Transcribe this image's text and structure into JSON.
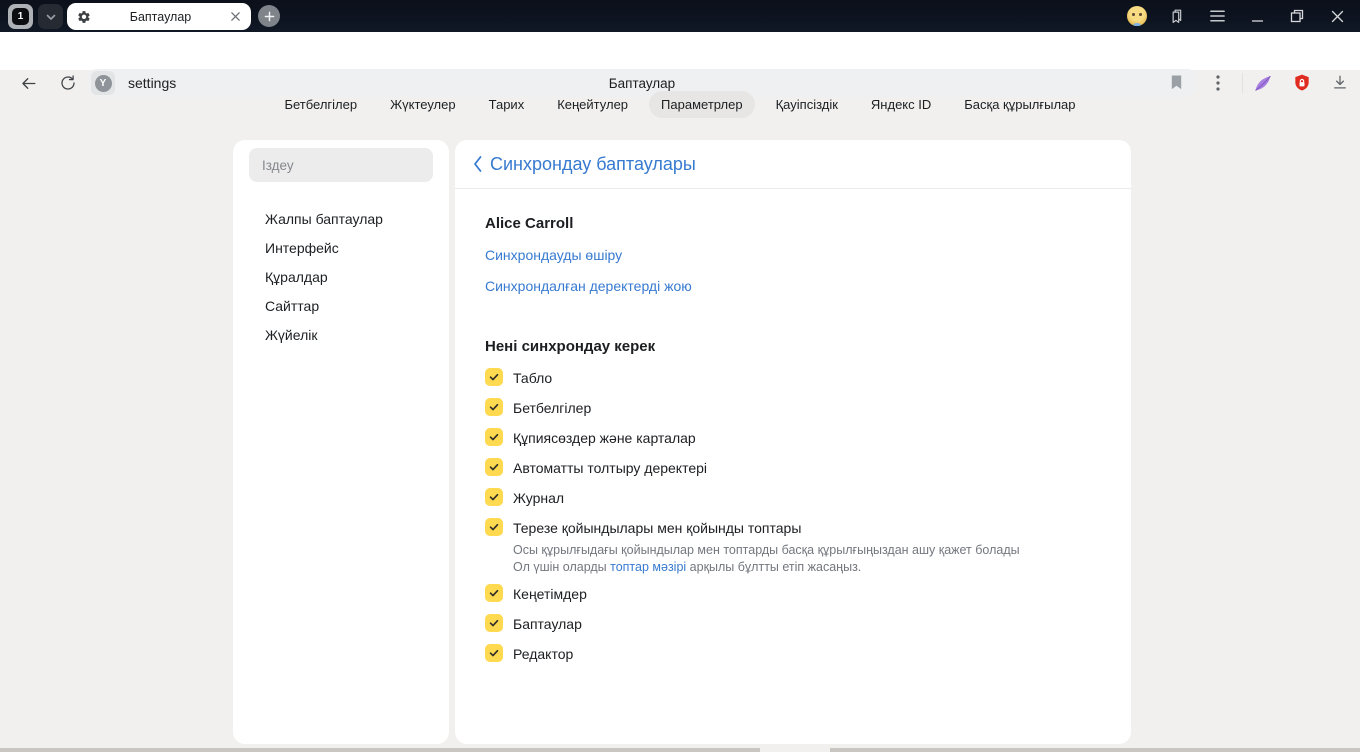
{
  "titlebar": {
    "tab_count": "1",
    "tab_title": "Баптаулар"
  },
  "toolbar": {
    "protect_letter": "Y",
    "url": "settings",
    "page_title": "Баптаулар"
  },
  "nav_tabs": [
    {
      "label": "Бетбелгілер",
      "active": false
    },
    {
      "label": "Жүктеулер",
      "active": false
    },
    {
      "label": "Тарих",
      "active": false
    },
    {
      "label": "Кеңейтулер",
      "active": false
    },
    {
      "label": "Параметрлер",
      "active": true
    },
    {
      "label": "Қауіпсіздік",
      "active": false
    },
    {
      "label": "Яндекс ID",
      "active": false
    },
    {
      "label": "Басқа құрылғылар",
      "active": false
    }
  ],
  "sidebar": {
    "search_placeholder": "Іздеу",
    "items": [
      "Жалпы баптаулар",
      "Интерфейс",
      "Құралдар",
      "Сайттар",
      "Жүйелік"
    ]
  },
  "main": {
    "heading": "Синхрондау баптаулары",
    "account_name": "Alice Carroll",
    "link_disable_sync": "Синхрондауды өшіру",
    "link_delete_synced": "Синхрондалған деректерді жою",
    "section_title": "Нені синхрондау керек",
    "items": [
      {
        "label": "Табло",
        "checked": true
      },
      {
        "label": "Бетбелгілер",
        "checked": true
      },
      {
        "label": "Құпиясөздер және карталар",
        "checked": true
      },
      {
        "label": "Автоматты толтыру деректері",
        "checked": true
      },
      {
        "label": "Журнал",
        "checked": true
      },
      {
        "label": "Терезе қойындылары мен қойынды топтары",
        "checked": true,
        "description_line1": "Осы құрылғыдағы қойындылар мен топтарды басқа құрылғыңыздан ашу қажет болады",
        "description_prefix": "Ол үшін оларды ",
        "description_link": "топтар мәзірі",
        "description_suffix": " арқылы бұлтты етіп жасаңыз."
      },
      {
        "label": "Кеңетімдер",
        "checked": true
      },
      {
        "label": "Баптаулар",
        "checked": true
      },
      {
        "label": "Редактор",
        "checked": true
      }
    ]
  },
  "colors": {
    "accent_blue": "#377ad0",
    "checkbox_yellow": "#ffd94f",
    "shield_red": "#e02b20",
    "feather_purple": "#9a6fd8",
    "titlebar_dark": "#0d1420"
  }
}
